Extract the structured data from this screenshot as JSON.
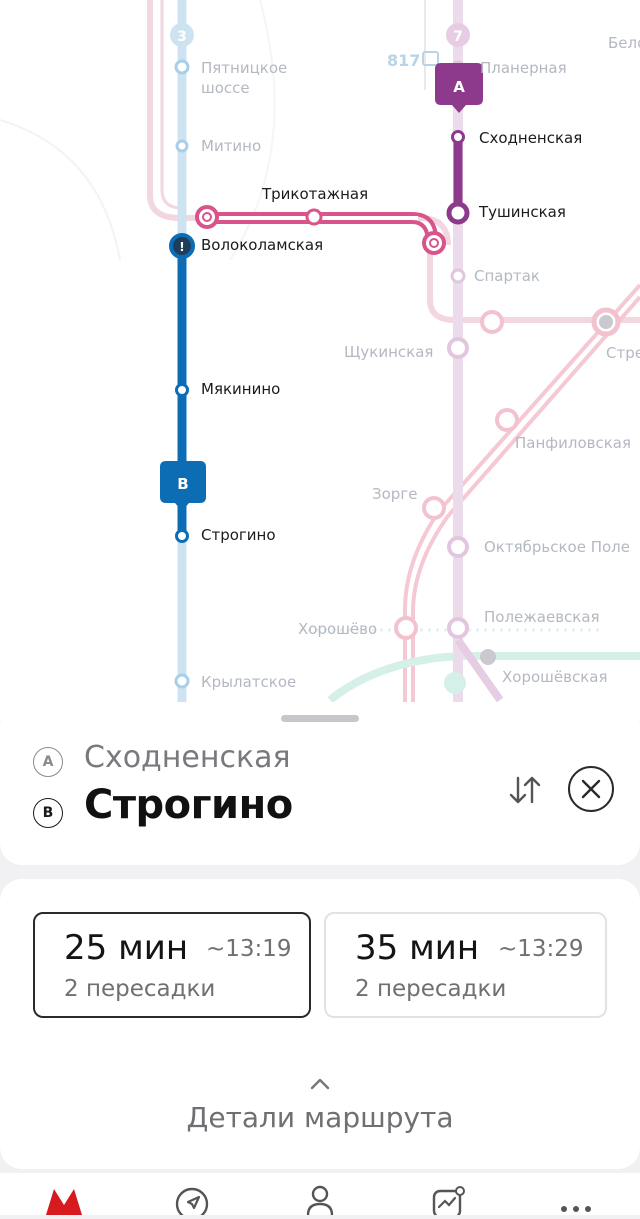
{
  "map": {
    "line_numbers": {
      "line_3": "3",
      "line_7": "7"
    },
    "counter": "817",
    "marker_a": "A",
    "marker_b": "B",
    "stations": {
      "pyatnitskoe_1": "Пятницкое",
      "pyatnitskoe_2": "шоссе",
      "mitino": "Митино",
      "volokolamskaya": "Волоколамская",
      "myakinino": "Мякинино",
      "strogino": "Строгино",
      "krylatskoe": "Крылатское",
      "trikotazhnaya": "Трикотажная",
      "planernaya": "Планерная",
      "skhodnenskaya": "Сходненская",
      "tushinskaya": "Тушинская",
      "spartak": "Спартак",
      "shchukinskaya": "Щукинская",
      "oktyabrskoe_pole": "Октябрьское Поле",
      "polezhaevskaya": "Полежаевская",
      "khoroshevskaya": "Хорошёвская",
      "khoroshevo": "Хорошёво",
      "zorge": "Зорге",
      "panfilovskaya": "Панфиловская",
      "stre_partial": "Стре",
      "bel_partial": "Бело"
    },
    "colors": {
      "line3": "#0c6db5",
      "line3_faded": "#cde3f1",
      "line7": "#8e3a8c",
      "line7_faded": "#ecdbea",
      "mcd": "#d9548a",
      "mcd_faded": "#f2d7e0"
    }
  },
  "route": {
    "from_badge": "A",
    "to_badge": "B",
    "from": "Сходненская",
    "to": "Строгино",
    "swap_icon": "swap-vertical-icon",
    "close_icon": "close-icon"
  },
  "options": [
    {
      "duration": "25 мин",
      "arrival": "~13:19",
      "transfers": "2 пересадки",
      "selected": true
    },
    {
      "duration": "35 мин",
      "arrival": "~13:29",
      "transfers": "2 пересадки",
      "selected": false
    }
  ],
  "details_label": "Детали маршрута",
  "bottom_nav": [
    "metro-logo-icon",
    "navigate-icon",
    "profile-icon",
    "stats-icon",
    "more-icon"
  ]
}
